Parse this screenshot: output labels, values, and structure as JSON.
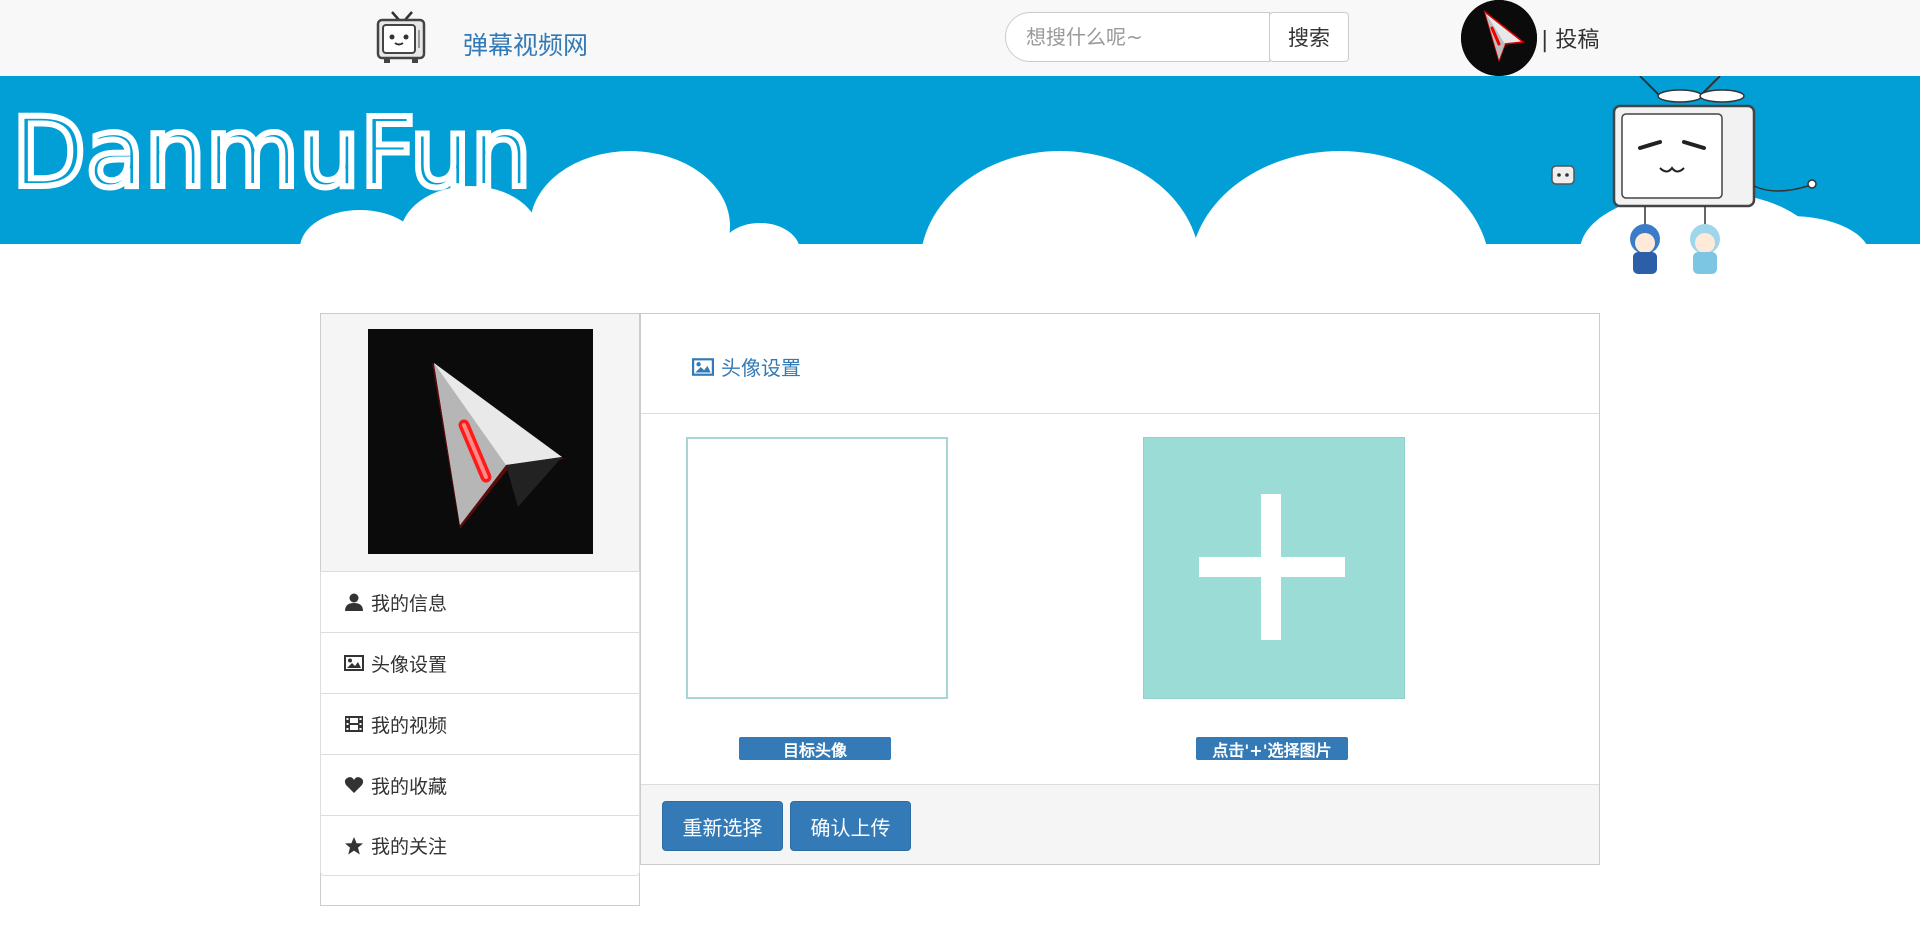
{
  "navbar": {
    "brand": "弹幕视频网",
    "search_placeholder": "想搜什么呢~",
    "search_button": "搜索",
    "contribute": "| 投稿"
  },
  "banner": {
    "logo_text": "DanmuFun",
    "bg_color": "#029fd7"
  },
  "sidebar": {
    "items": [
      {
        "label": "我的信息",
        "icon": "user-icon"
      },
      {
        "label": "头像设置",
        "icon": "picture-icon"
      },
      {
        "label": "我的视频",
        "icon": "film-icon"
      },
      {
        "label": "我的收藏",
        "icon": "heart-icon"
      },
      {
        "label": "我的关注",
        "icon": "star-icon"
      }
    ]
  },
  "main": {
    "title": "头像设置",
    "target_label": "目标头像",
    "select_label": "点击'+'选择图片",
    "reselect_button": "重新选择",
    "confirm_button": "确认上传"
  },
  "colors": {
    "accent": "#337ab7",
    "add_box": "#9bdcd6"
  }
}
